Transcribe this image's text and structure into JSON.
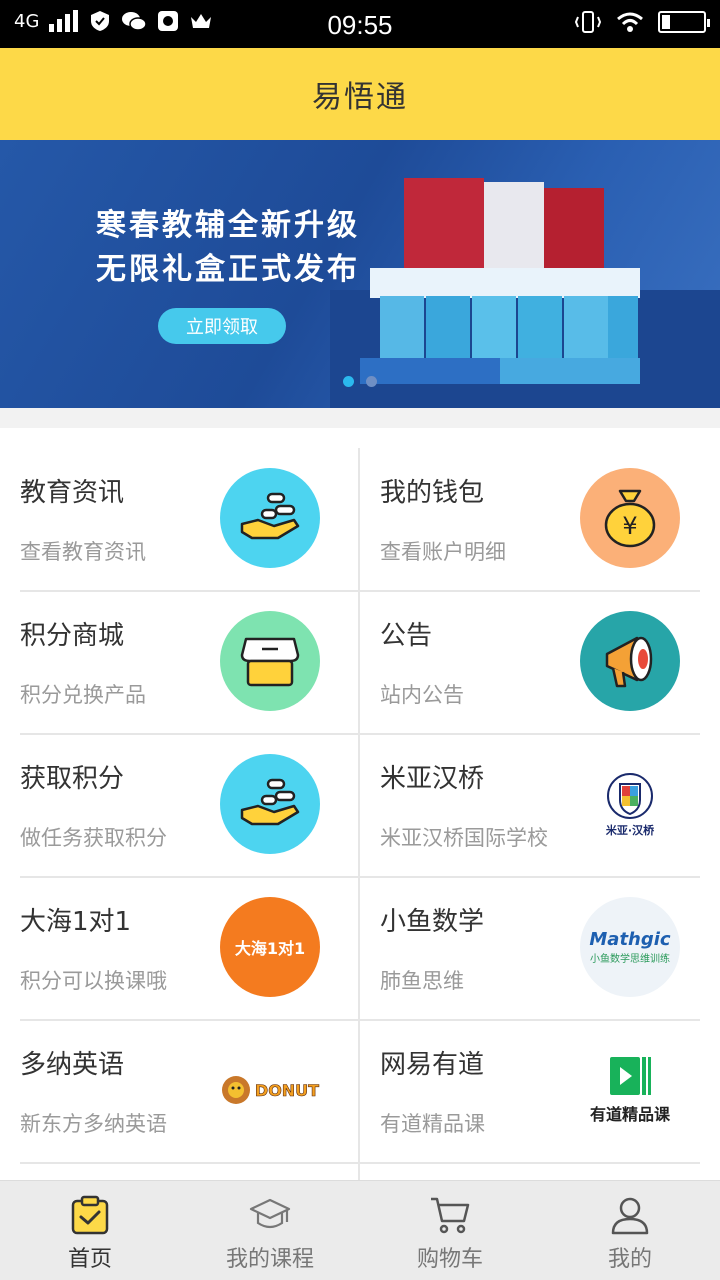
{
  "status_bar": {
    "network": "4G",
    "time": "09:55"
  },
  "header": {
    "title": "易悟通"
  },
  "banner": {
    "line1": "寒春教辅全新升级",
    "line2": "无限礼盒正式发布",
    "cta": "立即领取",
    "page_count": 2,
    "active_index": 0
  },
  "grid": [
    {
      "title": "教育资讯",
      "subtitle": "查看教育资讯",
      "icon": "hand-coins-icon",
      "color": "#4dd4f0"
    },
    {
      "title": "我的钱包",
      "subtitle": "查看账户明细",
      "icon": "money-bag-icon",
      "color": "#fbb078",
      "glyph": "¥"
    },
    {
      "title": "积分商城",
      "subtitle": "积分兑换产品",
      "icon": "store-icon",
      "color": "#7ee3b0"
    },
    {
      "title": "公告",
      "subtitle": "站内公告",
      "icon": "megaphone-icon",
      "color": "#27a5a8"
    },
    {
      "title": "获取积分",
      "subtitle": "做任务获取积分",
      "icon": "hand-coins-icon",
      "color": "#4dd4f0"
    },
    {
      "title": "米亚汉桥",
      "subtitle": "米亚汉桥国际学校",
      "icon": "school-crest-logo",
      "logo_text": "米亚·汉桥",
      "color": "#ffffff"
    },
    {
      "title": "大海1对1",
      "subtitle": "积分可以换课哦",
      "icon": "dahai-logo",
      "logo_text": "大海1对1",
      "color": "#f47b1f"
    },
    {
      "title": "小鱼数学",
      "subtitle": "肺鱼思维",
      "icon": "mathgic-logo",
      "logo_text": "Mathgic",
      "logo_sub": "小鱼数学思维训练",
      "color": "#eef3f8"
    },
    {
      "title": "多纳英语",
      "subtitle": "新东方多纳英语",
      "icon": "donut-logo",
      "logo_text": "DONUT",
      "color": "#ffffff"
    },
    {
      "title": "网易有道",
      "subtitle": "有道精品课",
      "icon": "youdao-logo",
      "logo_text": "有道精品课",
      "color": "#ffffff"
    }
  ],
  "bottom_nav": [
    {
      "label": "首页",
      "icon": "home-clipboard-icon",
      "active": true
    },
    {
      "label": "我的课程",
      "icon": "graduation-cap-icon",
      "active": false
    },
    {
      "label": "购物车",
      "icon": "cart-icon",
      "active": false
    },
    {
      "label": "我的",
      "icon": "user-icon",
      "active": false
    }
  ]
}
